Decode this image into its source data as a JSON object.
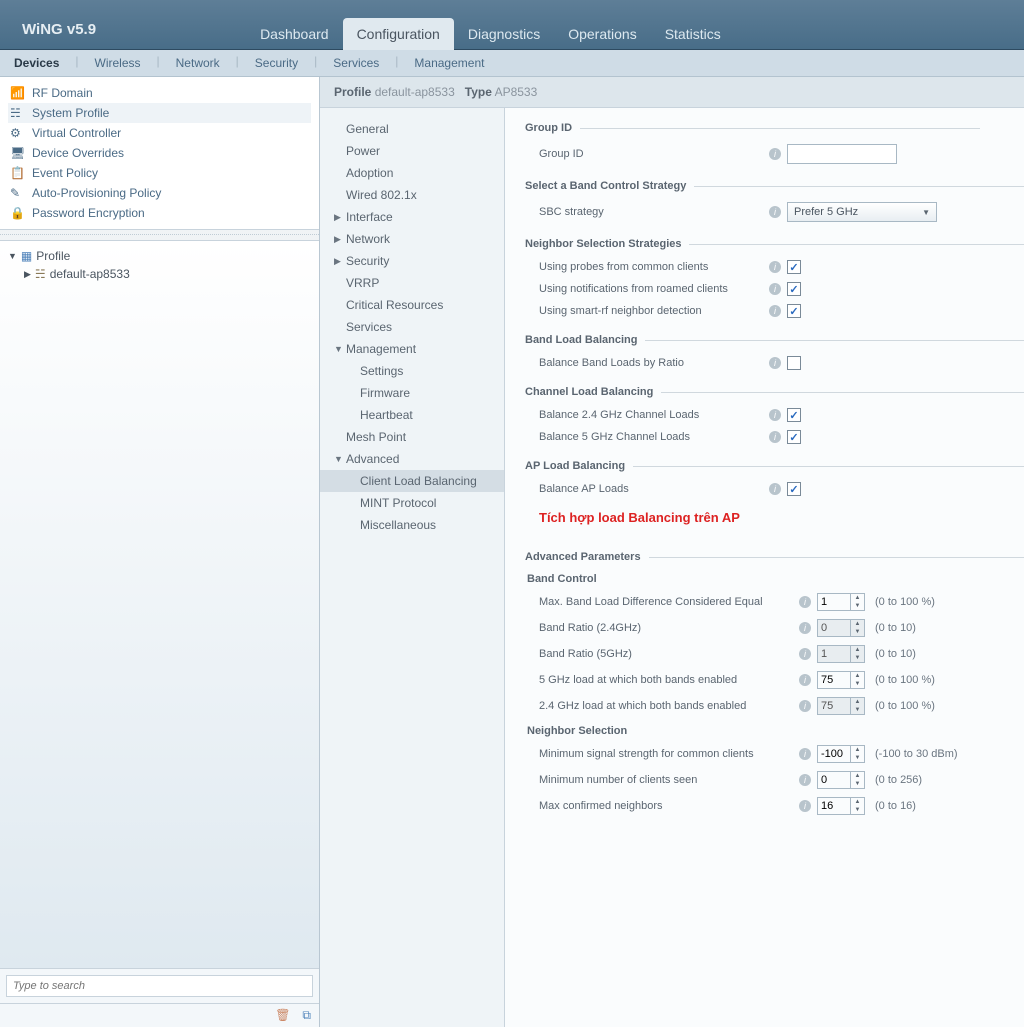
{
  "brand": "WiNG v5.9",
  "topnav": [
    "Dashboard",
    "Configuration",
    "Diagnostics",
    "Operations",
    "Statistics"
  ],
  "topnav_active": 1,
  "subnav": [
    "Devices",
    "Wireless",
    "Network",
    "Security",
    "Services",
    "Management"
  ],
  "subnav_active": 0,
  "devlist": [
    "RF Domain",
    "System Profile",
    "Virtual Controller",
    "Device Overrides",
    "Event Policy",
    "Auto-Provisioning Policy",
    "Password Encryption"
  ],
  "devlist_active": 1,
  "tree": {
    "root": "Profile",
    "child": "default-ap8533"
  },
  "search_placeholder": "Type to search",
  "crumb": {
    "k1": "Profile",
    "v1": "default-ap8533",
    "k2": "Type",
    "v2": "AP8533"
  },
  "midnav": [
    {
      "label": "General",
      "lvl": 0
    },
    {
      "label": "Power",
      "lvl": 0
    },
    {
      "label": "Adoption",
      "lvl": 0
    },
    {
      "label": "Wired 802.1x",
      "lvl": 0
    },
    {
      "label": "Interface",
      "lvl": 0,
      "caret": "▶"
    },
    {
      "label": "Network",
      "lvl": 0,
      "caret": "▶"
    },
    {
      "label": "Security",
      "lvl": 0,
      "caret": "▶"
    },
    {
      "label": "VRRP",
      "lvl": 0
    },
    {
      "label": "Critical Resources",
      "lvl": 0
    },
    {
      "label": "Services",
      "lvl": 0
    },
    {
      "label": "Management",
      "lvl": 0,
      "caret": "▼"
    },
    {
      "label": "Settings",
      "lvl": 1
    },
    {
      "label": "Firmware",
      "lvl": 1
    },
    {
      "label": "Heartbeat",
      "lvl": 1
    },
    {
      "label": "Mesh Point",
      "lvl": 0
    },
    {
      "label": "Advanced",
      "lvl": 0,
      "caret": "▼"
    },
    {
      "label": "Client Load Balancing",
      "lvl": 1,
      "active": true
    },
    {
      "label": "MINT Protocol",
      "lvl": 1
    },
    {
      "label": "Miscellaneous",
      "lvl": 1
    }
  ],
  "groups": {
    "groupid": {
      "title": "Group ID",
      "label": "Group ID",
      "value": ""
    },
    "band_strategy": {
      "title": "Select a Band Control Strategy",
      "label": "SBC strategy",
      "value": "Prefer 5 GHz"
    },
    "neighbor_sel": {
      "title": "Neighbor Selection Strategies",
      "items": [
        {
          "label": "Using probes from common clients",
          "checked": true
        },
        {
          "label": "Using notifications from roamed clients",
          "checked": true
        },
        {
          "label": "Using smart-rf neighbor detection",
          "checked": true
        }
      ]
    },
    "band_load": {
      "title": "Band Load Balancing",
      "label": "Balance Band Loads by Ratio",
      "checked": false
    },
    "channel_load": {
      "title": "Channel Load Balancing",
      "items": [
        {
          "label": "Balance 2.4 GHz Channel Loads",
          "checked": true
        },
        {
          "label": "Balance 5 GHz Channel Loads",
          "checked": true
        }
      ]
    },
    "ap_load": {
      "title": "AP Load Balancing",
      "label": "Balance AP Loads",
      "checked": true
    },
    "annotation": "Tích hợp load Balancing trên AP",
    "adv": {
      "title": "Advanced Parameters"
    },
    "band_control": {
      "title": "Band Control",
      "rows": [
        {
          "label": "Max. Band Load Difference Considered Equal",
          "val": "1",
          "hint": "(0 to 100 %)",
          "dis": false
        },
        {
          "label": "Band Ratio (2.4GHz)",
          "val": "0",
          "hint": "(0 to 10)",
          "dis": true
        },
        {
          "label": "Band Ratio (5GHz)",
          "val": "1",
          "hint": "(0 to 10)",
          "dis": true
        },
        {
          "label": "5 GHz load at which both bands enabled",
          "val": "75",
          "hint": "(0 to 100 %)",
          "dis": false
        },
        {
          "label": "2.4 GHz load at which both bands enabled",
          "val": "75",
          "hint": "(0 to 100 %)",
          "dis": true
        }
      ]
    },
    "neighbor_sel2": {
      "title": "Neighbor Selection",
      "rows": [
        {
          "label": "Minimum signal strength for common clients",
          "val": "-100",
          "hint": "(-100 to 30 dBm)"
        },
        {
          "label": "Minimum number of clients seen",
          "val": "0",
          "hint": "(0 to 256)"
        },
        {
          "label": "Max confirmed neighbors",
          "val": "16",
          "hint": "(0 to 16)"
        }
      ]
    }
  }
}
